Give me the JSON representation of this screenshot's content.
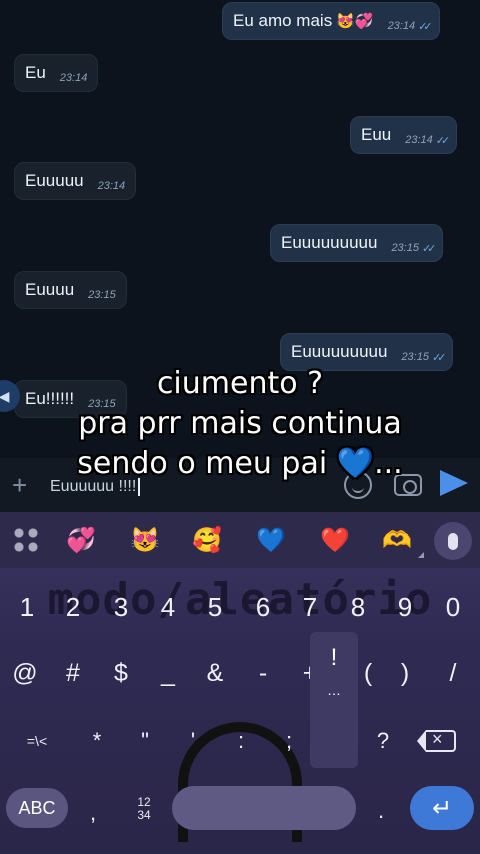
{
  "messages": [
    {
      "dir": "out",
      "text": "Eu amo mais",
      "emoji": "😻💞",
      "time": "23:14",
      "ticks": "✓✓"
    },
    {
      "dir": "in",
      "text": "Eu",
      "time": "23:14"
    },
    {
      "dir": "out",
      "text": "Euu",
      "time": "23:14",
      "ticks": "✓✓"
    },
    {
      "dir": "in",
      "text": "Euuuuu",
      "time": "23:14"
    },
    {
      "dir": "out",
      "text": "Euuuuuuuuu",
      "time": "23:15",
      "ticks": "✓✓"
    },
    {
      "dir": "in",
      "text": "Euuuu",
      "time": "23:15"
    },
    {
      "dir": "out",
      "text": "Euuuuuuuuu",
      "time": "23:15",
      "ticks": "✓✓"
    },
    {
      "dir": "in",
      "text": "Eu!!!!!!",
      "time": "23:15"
    }
  ],
  "input": {
    "value": "Euuuuuu !!!!"
  },
  "overlay": {
    "line1": "ciumento ?",
    "line2": "pra prr mais continua",
    "line3": "sendo o meu pai 💙..."
  },
  "keyboard": {
    "emoji_row": [
      "💞",
      "😻",
      "🥰",
      "💙",
      "❤️",
      "🫶"
    ],
    "watermark": "modo/aleatório",
    "numbers": [
      "1",
      "2",
      "3",
      "4",
      "5",
      "6",
      "7",
      "8",
      "9",
      "0"
    ],
    "symbols1": [
      "@",
      "#",
      "$",
      "_",
      "&",
      "-",
      "+",
      "(",
      ")",
      "/"
    ],
    "symbols2": [
      "=\\<",
      "*",
      "\"",
      "'",
      ":",
      ";",
      "!",
      "?"
    ],
    "popup": [
      "!",
      "…"
    ],
    "abc_label": "ABC",
    "comma": ",",
    "numswitch": "12\n34",
    "period": ".",
    "enter_symbol": "↵"
  },
  "colors": {
    "accent": "#4b8fe8",
    "outgoing": "#213248",
    "incoming": "#18212c"
  }
}
